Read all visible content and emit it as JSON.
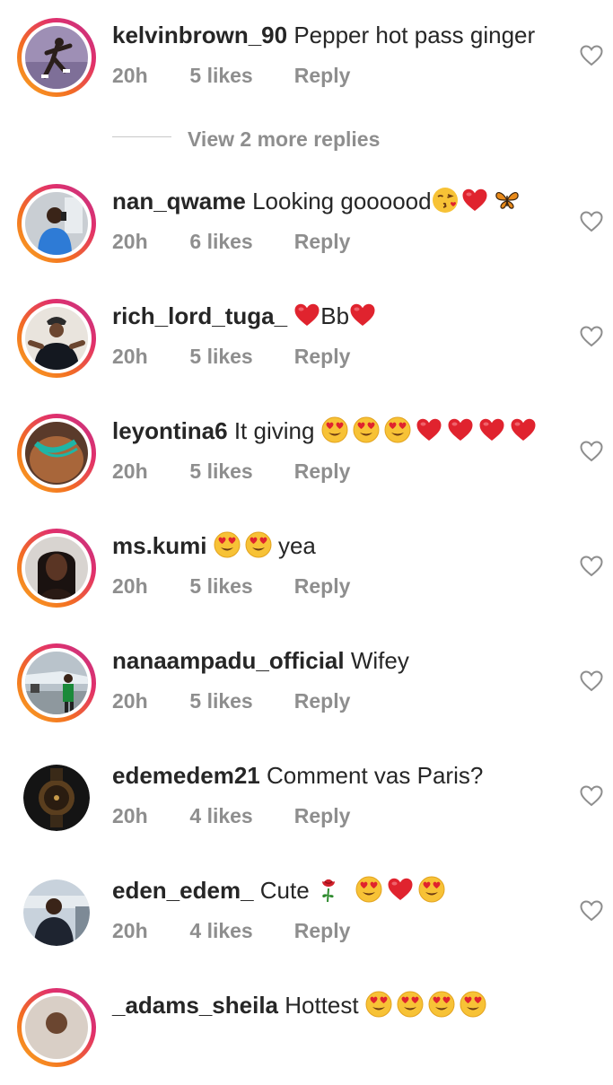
{
  "comments": [
    {
      "username": "kelvinbrown_90",
      "text": "Pepper hot pass ginger",
      "time": "20h",
      "likes": "5 likes",
      "reply": "Reply",
      "avatar_ring": "story"
    },
    {
      "username": "nan_qwame",
      "text": "Looking goooood",
      "emojis": [
        "face-blowing-kiss",
        "red-heart",
        "butterfly"
      ],
      "time": "20h",
      "likes": "6 likes",
      "reply": "Reply",
      "avatar_ring": "story"
    },
    {
      "username": "rich_lord_tuga_",
      "text": "Bb",
      "emojis": [
        "red-heart",
        "red-heart"
      ],
      "time": "20h",
      "likes": "5 likes",
      "reply": "Reply",
      "avatar_ring": "story"
    },
    {
      "username": "leyontina6",
      "text": "It giving",
      "emojis": [
        "heart-eyes",
        "heart-eyes",
        "heart-eyes",
        "red-heart",
        "red-heart",
        "red-heart",
        "red-heart"
      ],
      "time": "20h",
      "likes": "5 likes",
      "reply": "Reply",
      "avatar_ring": "story"
    },
    {
      "username": "ms.kumi",
      "text": "yea",
      "emojis": [
        "heart-eyes",
        "heart-eyes"
      ],
      "time": "20h",
      "likes": "5 likes",
      "reply": "Reply",
      "avatar_ring": "story"
    },
    {
      "username": "nanaampadu_official",
      "text": "Wifey",
      "time": "20h",
      "likes": "5 likes",
      "reply": "Reply",
      "avatar_ring": "story"
    },
    {
      "username": "edemedem21",
      "text": "Comment vas Paris?",
      "time": "20h",
      "likes": "4 likes",
      "reply": "Reply",
      "avatar_ring": "none"
    },
    {
      "username": "eden_edem_",
      "text": "Cute",
      "emojis": [
        "rose",
        "heart-eyes",
        "red-heart",
        "heart-eyes"
      ],
      "time": "20h",
      "likes": "4 likes",
      "reply": "Reply",
      "avatar_ring": "none"
    },
    {
      "username": "_adams_sheila",
      "text": "Hottest",
      "emojis": [
        "heart-eyes",
        "heart-eyes",
        "heart-eyes",
        "heart-eyes"
      ],
      "avatar_ring": "story"
    }
  ],
  "view_more_replies": "View 2 more replies",
  "icons": {
    "like": "heart-outline-icon"
  },
  "colors": {
    "username": "#262626",
    "meta": "#8e8e8e",
    "heart_outline": "#8e8e8e",
    "emoji_heart": "#e0232e",
    "emoji_face": "#f7c236"
  }
}
